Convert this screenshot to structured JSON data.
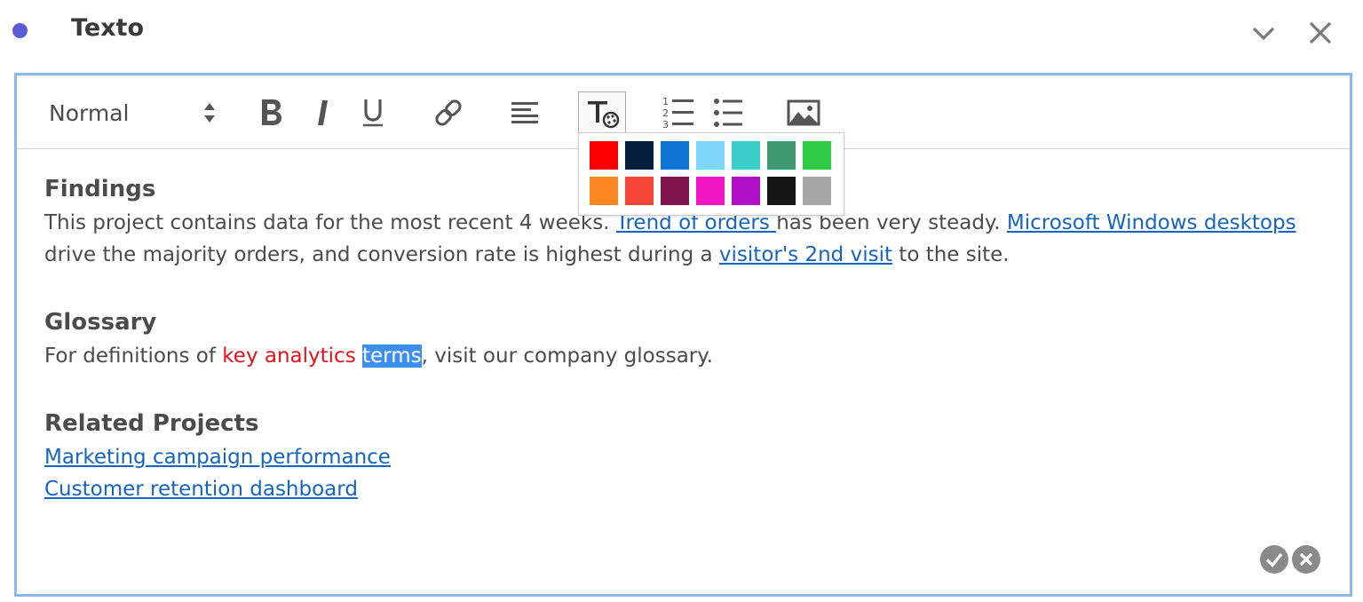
{
  "header": {
    "title": "Texto",
    "accent_dot_color": "#5b5bd6",
    "collapse_icon": "chevron-down-icon",
    "close_icon": "close-icon"
  },
  "toolbar": {
    "paragraph_style": "Normal",
    "buttons": [
      "bold-icon",
      "italic-icon",
      "underline-icon",
      "link-icon",
      "align-icon",
      "text-color-icon",
      "numbered-list-icon",
      "bulleted-list-icon",
      "image-icon"
    ],
    "active_button": "text-color-icon"
  },
  "color_palette": {
    "colors": [
      "#ff0000",
      "#041e3e",
      "#0d74d6",
      "#7fd6fb",
      "#3acdc9",
      "#3f9a73",
      "#2ecb46",
      "#fd8823",
      "#f8453a",
      "#7f154c",
      "#f115c5",
      "#b010c8",
      "#161616",
      "#a7a7a7"
    ]
  },
  "content": {
    "findings": {
      "heading": "Findings",
      "text1": "This project contains data for the most recent 4 weeks. ",
      "link1": "Trend of orders ",
      "text2": "has been very steady. ",
      "link2": "Microsoft Windows desktops",
      "text3": " drive the majority orders, and conversion rate is highest during a ",
      "link3": "visitor's 2nd visit",
      "text4": " to the site."
    },
    "glossary": {
      "heading": "Glossary",
      "text1": "For definitions of ",
      "red_text": "key analytics",
      "space": " ",
      "selected_text": "terms",
      "text2": ", visit our company glossary.",
      "red_color": "#e8121c",
      "selection_color": "#3e8ef0"
    },
    "related": {
      "heading": "Related Projects",
      "links": [
        "Marketing campaign performance",
        "Customer retention dashboard"
      ]
    }
  },
  "footer": {
    "confirm_icon": "checkmark-circle-icon",
    "cancel_icon": "close-circle-icon"
  }
}
